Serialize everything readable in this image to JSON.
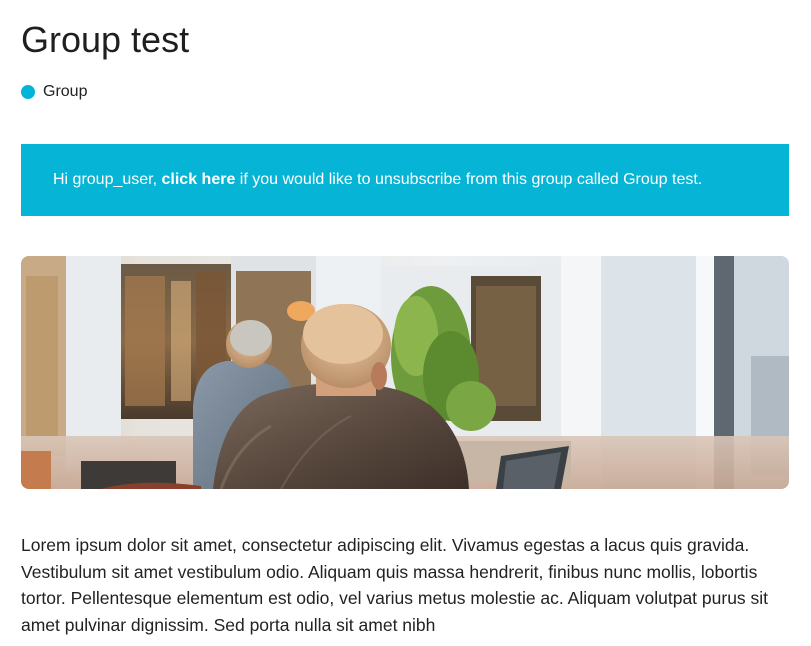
{
  "page": {
    "title": "Group test",
    "type_label": "Group",
    "type_dot_color": "#04b4d8"
  },
  "banner": {
    "background_color": "#06b4d6",
    "greeting": "Hi group_user, ",
    "link_text": "click here",
    "message": " if you would like to unsubscribe from this group called Group test."
  },
  "hero_image": {
    "description_name": "people-sitting-at-cafe-photo"
  },
  "content": {
    "body": "Lorem ipsum dolor sit amet, consectetur adipiscing elit. Vivamus egestas a lacus quis gravida. Vestibulum sit amet vestibulum odio. Aliquam quis massa hendrerit, finibus nunc mollis, lobortis tortor. Pellentesque elementum est odio, vel varius metus molestie ac. Aliquam volutpat purus sit amet pulvinar dignissim. Sed porta nulla sit amet nibh"
  }
}
